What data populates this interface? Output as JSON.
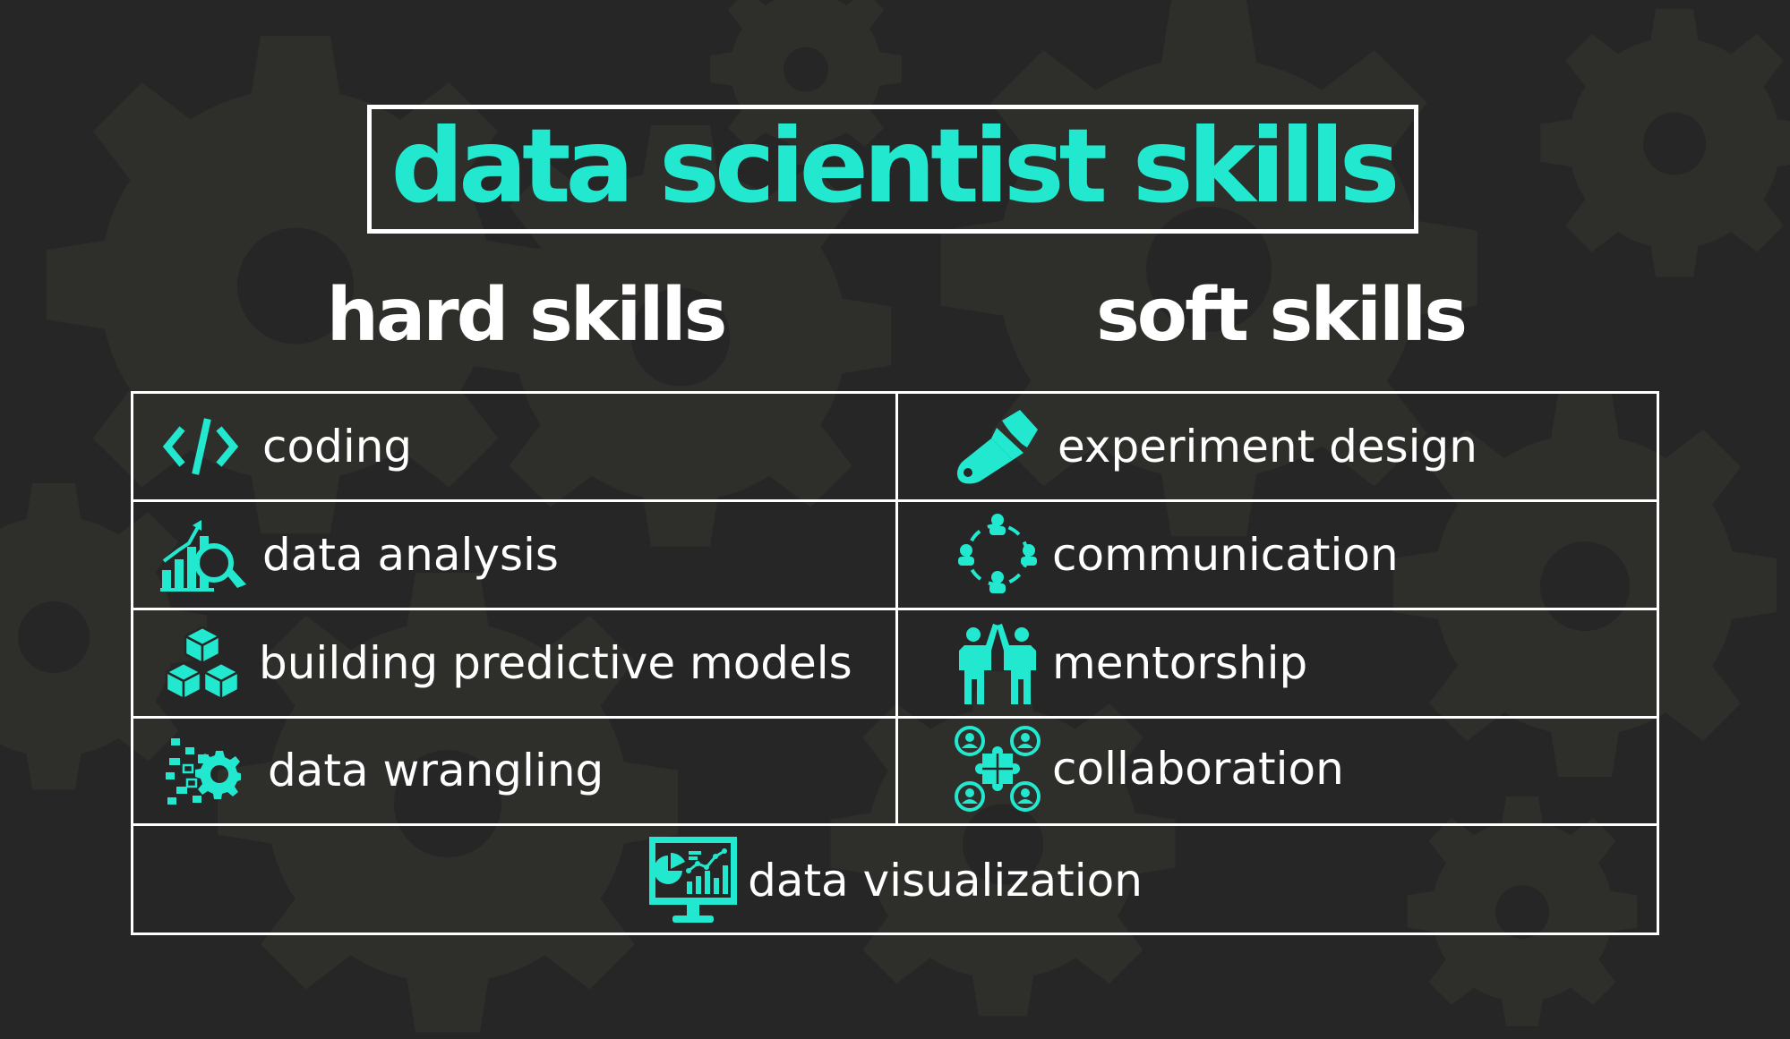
{
  "title": "data scientist skills",
  "hard_skills": {
    "heading": "hard skills",
    "items": [
      {
        "label": "coding",
        "icon": "code-icon"
      },
      {
        "label": "data analysis",
        "icon": "chart-magnifier-icon"
      },
      {
        "label": "building predictive models",
        "icon": "cubes-icon"
      },
      {
        "label": "data wrangling",
        "icon": "data-gear-icon"
      }
    ]
  },
  "soft_skills": {
    "heading": "soft skills",
    "items": [
      {
        "label": "experiment design",
        "icon": "paintbrush-icon"
      },
      {
        "label": "communication",
        "icon": "people-network-icon"
      },
      {
        "label": "mentorship",
        "icon": "high-five-icon"
      },
      {
        "label": "collaboration",
        "icon": "puzzle-team-icon"
      }
    ]
  },
  "shared_skill": {
    "label": "data visualization",
    "icon": "monitor-chart-icon"
  },
  "colors": {
    "accent": "#23e8d0",
    "background": "#262626",
    "text": "#ffffff",
    "gear_pattern": "#2e2e2a"
  }
}
